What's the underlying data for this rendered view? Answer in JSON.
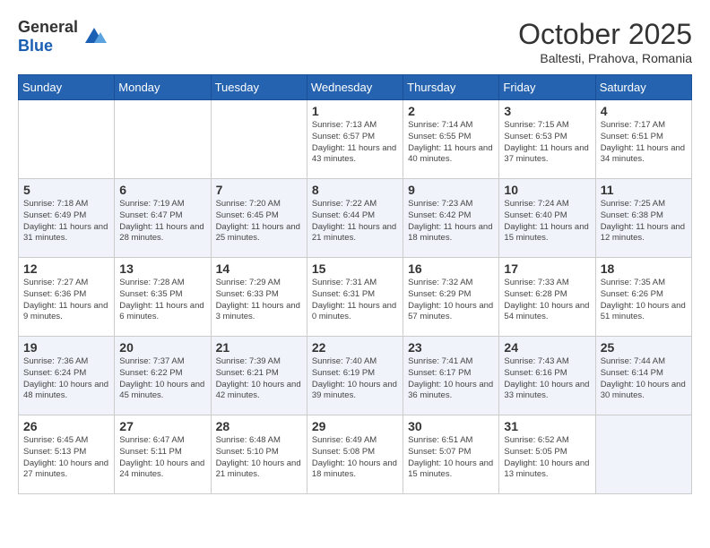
{
  "header": {
    "logo_general": "General",
    "logo_blue": "Blue",
    "month": "October 2025",
    "location": "Baltesti, Prahova, Romania"
  },
  "days_of_week": [
    "Sunday",
    "Monday",
    "Tuesday",
    "Wednesday",
    "Thursday",
    "Friday",
    "Saturday"
  ],
  "weeks": [
    {
      "row_class": "odd-row",
      "days": [
        {
          "number": "",
          "info": ""
        },
        {
          "number": "",
          "info": ""
        },
        {
          "number": "",
          "info": ""
        },
        {
          "number": "1",
          "info": "Sunrise: 7:13 AM\nSunset: 6:57 PM\nDaylight: 11 hours\nand 43 minutes."
        },
        {
          "number": "2",
          "info": "Sunrise: 7:14 AM\nSunset: 6:55 PM\nDaylight: 11 hours\nand 40 minutes."
        },
        {
          "number": "3",
          "info": "Sunrise: 7:15 AM\nSunset: 6:53 PM\nDaylight: 11 hours\nand 37 minutes."
        },
        {
          "number": "4",
          "info": "Sunrise: 7:17 AM\nSunset: 6:51 PM\nDaylight: 11 hours\nand 34 minutes."
        }
      ]
    },
    {
      "row_class": "even-row",
      "days": [
        {
          "number": "5",
          "info": "Sunrise: 7:18 AM\nSunset: 6:49 PM\nDaylight: 11 hours\nand 31 minutes."
        },
        {
          "number": "6",
          "info": "Sunrise: 7:19 AM\nSunset: 6:47 PM\nDaylight: 11 hours\nand 28 minutes."
        },
        {
          "number": "7",
          "info": "Sunrise: 7:20 AM\nSunset: 6:45 PM\nDaylight: 11 hours\nand 25 minutes."
        },
        {
          "number": "8",
          "info": "Sunrise: 7:22 AM\nSunset: 6:44 PM\nDaylight: 11 hours\nand 21 minutes."
        },
        {
          "number": "9",
          "info": "Sunrise: 7:23 AM\nSunset: 6:42 PM\nDaylight: 11 hours\nand 18 minutes."
        },
        {
          "number": "10",
          "info": "Sunrise: 7:24 AM\nSunset: 6:40 PM\nDaylight: 11 hours\nand 15 minutes."
        },
        {
          "number": "11",
          "info": "Sunrise: 7:25 AM\nSunset: 6:38 PM\nDaylight: 11 hours\nand 12 minutes."
        }
      ]
    },
    {
      "row_class": "odd-row",
      "days": [
        {
          "number": "12",
          "info": "Sunrise: 7:27 AM\nSunset: 6:36 PM\nDaylight: 11 hours\nand 9 minutes."
        },
        {
          "number": "13",
          "info": "Sunrise: 7:28 AM\nSunset: 6:35 PM\nDaylight: 11 hours\nand 6 minutes."
        },
        {
          "number": "14",
          "info": "Sunrise: 7:29 AM\nSunset: 6:33 PM\nDaylight: 11 hours\nand 3 minutes."
        },
        {
          "number": "15",
          "info": "Sunrise: 7:31 AM\nSunset: 6:31 PM\nDaylight: 11 hours\nand 0 minutes."
        },
        {
          "number": "16",
          "info": "Sunrise: 7:32 AM\nSunset: 6:29 PM\nDaylight: 10 hours\nand 57 minutes."
        },
        {
          "number": "17",
          "info": "Sunrise: 7:33 AM\nSunset: 6:28 PM\nDaylight: 10 hours\nand 54 minutes."
        },
        {
          "number": "18",
          "info": "Sunrise: 7:35 AM\nSunset: 6:26 PM\nDaylight: 10 hours\nand 51 minutes."
        }
      ]
    },
    {
      "row_class": "even-row",
      "days": [
        {
          "number": "19",
          "info": "Sunrise: 7:36 AM\nSunset: 6:24 PM\nDaylight: 10 hours\nand 48 minutes."
        },
        {
          "number": "20",
          "info": "Sunrise: 7:37 AM\nSunset: 6:22 PM\nDaylight: 10 hours\nand 45 minutes."
        },
        {
          "number": "21",
          "info": "Sunrise: 7:39 AM\nSunset: 6:21 PM\nDaylight: 10 hours\nand 42 minutes."
        },
        {
          "number": "22",
          "info": "Sunrise: 7:40 AM\nSunset: 6:19 PM\nDaylight: 10 hours\nand 39 minutes."
        },
        {
          "number": "23",
          "info": "Sunrise: 7:41 AM\nSunset: 6:17 PM\nDaylight: 10 hours\nand 36 minutes."
        },
        {
          "number": "24",
          "info": "Sunrise: 7:43 AM\nSunset: 6:16 PM\nDaylight: 10 hours\nand 33 minutes."
        },
        {
          "number": "25",
          "info": "Sunrise: 7:44 AM\nSunset: 6:14 PM\nDaylight: 10 hours\nand 30 minutes."
        }
      ]
    },
    {
      "row_class": "odd-row last-row",
      "days": [
        {
          "number": "26",
          "info": "Sunrise: 6:45 AM\nSunset: 5:13 PM\nDaylight: 10 hours\nand 27 minutes."
        },
        {
          "number": "27",
          "info": "Sunrise: 6:47 AM\nSunset: 5:11 PM\nDaylight: 10 hours\nand 24 minutes."
        },
        {
          "number": "28",
          "info": "Sunrise: 6:48 AM\nSunset: 5:10 PM\nDaylight: 10 hours\nand 21 minutes."
        },
        {
          "number": "29",
          "info": "Sunrise: 6:49 AM\nSunset: 5:08 PM\nDaylight: 10 hours\nand 18 minutes."
        },
        {
          "number": "30",
          "info": "Sunrise: 6:51 AM\nSunset: 5:07 PM\nDaylight: 10 hours\nand 15 minutes."
        },
        {
          "number": "31",
          "info": "Sunrise: 6:52 AM\nSunset: 5:05 PM\nDaylight: 10 hours\nand 13 minutes."
        },
        {
          "number": "",
          "info": ""
        }
      ]
    }
  ]
}
